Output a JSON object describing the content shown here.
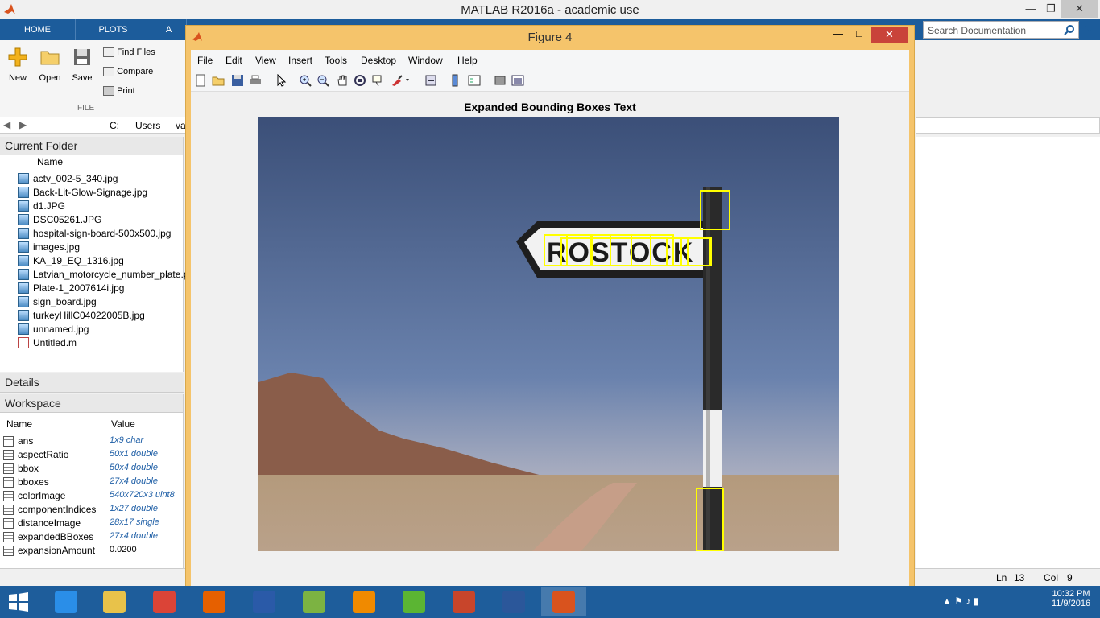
{
  "matlab": {
    "title": "MATLAB R2016a - academic use",
    "tabs": [
      "HOME",
      "PLOTS",
      "A"
    ],
    "toolstrip": {
      "new": "New",
      "open": "Open",
      "save": "Save",
      "find_files": "Find Files",
      "compare": "Compare",
      "print": "Print",
      "section": "FILE"
    },
    "search_placeholder": "Search Documentation",
    "address": [
      "C:",
      "Users",
      "va"
    ]
  },
  "current_folder": {
    "title": "Current Folder",
    "col_name": "Name",
    "files": [
      "actv_002-5_340.jpg",
      "Back-Lit-Glow-Signage.jpg",
      "d1.JPG",
      "DSC05261.JPG",
      "hospital-sign-board-500x500.jpg",
      "images.jpg",
      "KA_19_EQ_1316.jpg",
      "Latvian_motorcycle_number_plate.p",
      "Plate-1_2007614i.jpg",
      "sign_board.jpg",
      "turkeyHillC04022005B.jpg",
      "unnamed.jpg",
      "Untitled.m"
    ]
  },
  "details": {
    "title": "Details"
  },
  "workspace": {
    "title": "Workspace",
    "col_name": "Name",
    "col_value": "Value",
    "vars": [
      {
        "name": "ans",
        "value": "1x9 char"
      },
      {
        "name": "aspectRatio",
        "value": "50x1 double"
      },
      {
        "name": "bbox",
        "value": "50x4 double"
      },
      {
        "name": "bboxes",
        "value": "27x4 double"
      },
      {
        "name": "colorImage",
        "value": "540x720x3 uint8"
      },
      {
        "name": "componentIndices",
        "value": "1x27 double"
      },
      {
        "name": "distanceImage",
        "value": "28x17 single"
      },
      {
        "name": "expandedBBoxes",
        "value": "27x4 double"
      },
      {
        "name": "expansionAmount",
        "value": "0.0200"
      }
    ]
  },
  "status": {
    "ln_label": "Ln",
    "ln": "13",
    "col_label": "Col",
    "col": "9"
  },
  "figure": {
    "title": "Figure 4",
    "menu": [
      "File",
      "Edit",
      "View",
      "Insert",
      "Tools",
      "Desktop",
      "Window",
      "Help"
    ],
    "plot_title": "Expanded Bounding Boxes Text"
  },
  "taskbar": {
    "apps": [
      "ie-icon",
      "file-explorer-icon",
      "chrome-icon",
      "firefox-icon",
      "devcpp-icon",
      "bluestacks-icon",
      "vlc-icon",
      "utorrent-icon",
      "powerpoint-icon",
      "word-icon",
      "matlab-icon"
    ],
    "time": "10:32 PM",
    "date": "11/9/2016"
  },
  "colors": {
    "bbox": "#ffff00",
    "taskbar": "#1e5d9b",
    "figure_frame": "#f5c46b",
    "matlab_tabs": "#1c5c9b"
  }
}
